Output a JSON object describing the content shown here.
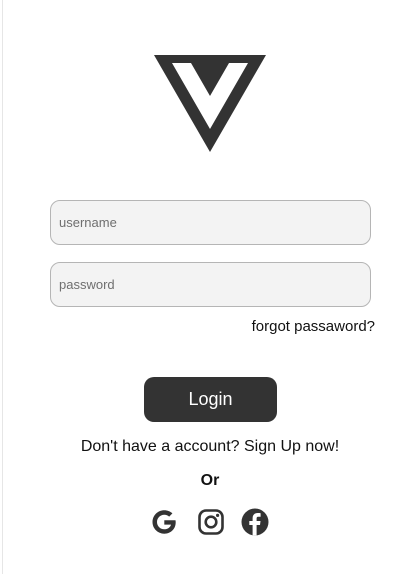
{
  "form": {
    "username_placeholder": "username",
    "password_placeholder": "password",
    "forgot_label": "forgot passaword?",
    "login_label": "Login",
    "signup_text": "Don't have a account? Sign Up now!",
    "or_label": "Or"
  },
  "social": [
    {
      "icon": "google-icon"
    },
    {
      "icon": "instagram-icon"
    },
    {
      "icon": "facebook-icon"
    }
  ],
  "colors": {
    "primary": "#333333",
    "field_bg": "#f3f3f3",
    "field_border": "#b5b5b5",
    "background": "#ffffff"
  }
}
